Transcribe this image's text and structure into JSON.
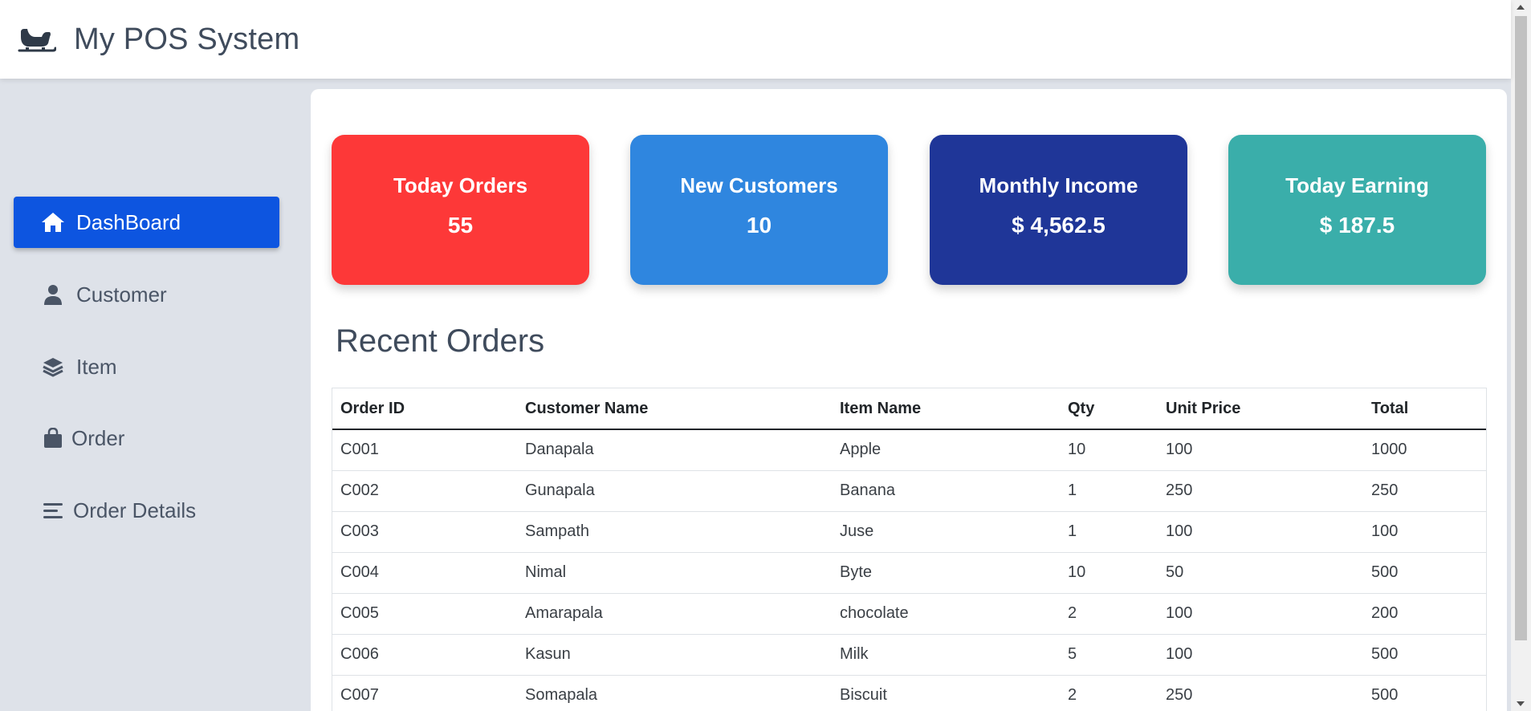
{
  "header": {
    "title": "My POS System",
    "logo_icon": "sleigh-icon"
  },
  "sidebar": {
    "items": [
      {
        "label": "DashBoard",
        "icon": "home-icon",
        "active": true
      },
      {
        "label": "Customer",
        "icon": "user-icon",
        "active": false
      },
      {
        "label": "Item",
        "icon": "layers-icon",
        "active": false
      },
      {
        "label": "Order",
        "icon": "shopping-bag-icon",
        "active": false
      },
      {
        "label": "Order Details",
        "icon": "list-icon",
        "active": false
      }
    ]
  },
  "cards": [
    {
      "title": "Today Orders",
      "value": "55",
      "color": "#fd3838"
    },
    {
      "title": "New Customers",
      "value": "10",
      "color": "#2f86df"
    },
    {
      "title": "Monthly Income",
      "value": "$ 4,562.5",
      "color": "#1f3698"
    },
    {
      "title": "Today Earning",
      "value": "$ 187.5",
      "color": "#3aaeaa"
    }
  ],
  "recent_orders": {
    "title": "Recent Orders",
    "columns": [
      "Order ID",
      "Customer Name",
      "Item Name",
      "Qty",
      "Unit Price",
      "Total"
    ],
    "rows": [
      [
        "C001",
        "Danapala",
        "Apple",
        "10",
        "100",
        "1000"
      ],
      [
        "C002",
        "Gunapala",
        "Banana",
        "1",
        "250",
        "250"
      ],
      [
        "C003",
        "Sampath",
        "Juse",
        "1",
        "100",
        "100"
      ],
      [
        "C004",
        "Nimal",
        "Byte",
        "10",
        "50",
        "500"
      ],
      [
        "C005",
        "Amarapala",
        "chocolate",
        "2",
        "100",
        "200"
      ],
      [
        "C006",
        "Kasun",
        "Milk",
        "5",
        "100",
        "500"
      ],
      [
        "C007",
        "Somapala",
        "Biscuit",
        "2",
        "250",
        "500"
      ]
    ]
  },
  "colors": {
    "accent": "#0d55e0",
    "sidebar_bg": "#dee2e9",
    "text_dark": "#3f4b5c"
  }
}
